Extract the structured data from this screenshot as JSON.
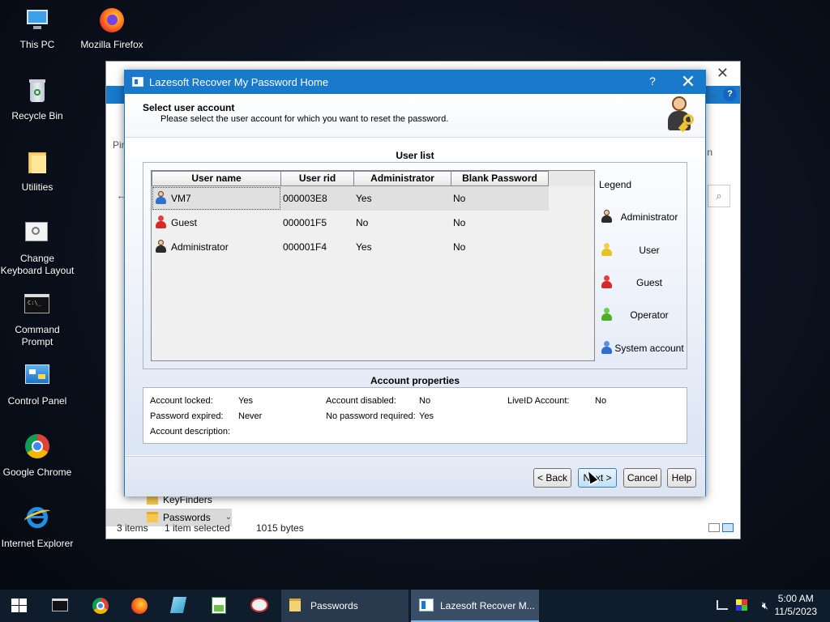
{
  "desktop": {
    "icons": [
      {
        "label": "This PC",
        "icon": "computer-icon"
      },
      {
        "label": "Mozilla Firefox",
        "icon": "firefox-icon"
      },
      {
        "label": "Recycle Bin",
        "icon": "recycle-bin-icon"
      },
      {
        "label": "Utilities",
        "icon": "folder-icon"
      },
      {
        "label": "Change Keyboard Layout",
        "icon": "keyboard-layout-icon"
      },
      {
        "label": "Command Prompt",
        "icon": "command-prompt-icon"
      },
      {
        "label": "Control Panel",
        "icon": "control-panel-icon"
      },
      {
        "label": "Google Chrome",
        "icon": "chrome-icon"
      },
      {
        "label": "Internet Explorer",
        "icon": "internet-explorer-icon"
      }
    ]
  },
  "explorer": {
    "pin_partial": "Pin",
    "edge_partial": "n",
    "nav_items": [
      {
        "label": "KeyFinders"
      },
      {
        "label": "Passwords"
      }
    ],
    "status": {
      "items": "3 items",
      "selected": "1 item selected",
      "size": "1015 bytes"
    }
  },
  "dialog": {
    "title": "Lazesoft Recover My Password Home",
    "help_label": "?",
    "close_label": "✕",
    "header_title": "Select user account",
    "header_subtitle": "Please select the user account for which you want to reset the password.",
    "user_list_title": "User list",
    "columns": [
      "User name",
      "User rid",
      "Administrator",
      "Blank Password"
    ],
    "rows": [
      {
        "name": "VM7",
        "rid": "000003E8",
        "admin": "Yes",
        "blank": "No",
        "type": "administrator",
        "selected": true
      },
      {
        "name": "Guest",
        "rid": "000001F5",
        "admin": "No",
        "blank": "No",
        "type": "guest",
        "selected": false
      },
      {
        "name": "Administrator",
        "rid": "000001F4",
        "admin": "Yes",
        "blank": "No",
        "type": "administrator",
        "selected": false
      }
    ],
    "legend": {
      "title": "Legend",
      "items": [
        {
          "label": "Administrator",
          "type": "administrator"
        },
        {
          "label": "User",
          "type": "user"
        },
        {
          "label": "Guest",
          "type": "guest"
        },
        {
          "label": "Operator",
          "type": "operator"
        },
        {
          "label": "System account",
          "type": "system"
        }
      ]
    },
    "account_properties_title": "Account properties",
    "properties": {
      "locked_label": "Account locked:",
      "locked_value": "Yes",
      "disabled_label": "Account disabled:",
      "disabled_value": "No",
      "liveid_label": "LiveID Account:",
      "liveid_value": "No",
      "expired_label": "Password expired:",
      "expired_value": "Never",
      "nopw_label": "No password required:",
      "nopw_value": "Yes",
      "description_label": "Account description:",
      "description_value": ""
    },
    "buttons": {
      "back": "< Back",
      "next": "Next >",
      "cancel": "Cancel",
      "help": "Help"
    }
  },
  "taskbar": {
    "pinned": [
      "start-icon",
      "command-prompt-icon",
      "chrome-icon",
      "firefox-icon",
      "notepad-icon",
      "spreadsheet-icon",
      "paint-icon"
    ],
    "tasks": [
      {
        "label": "Passwords",
        "icon": "folder-icon"
      },
      {
        "label": "Lazesoft Recover M...",
        "icon": "lazesoft-icon"
      }
    ],
    "clock": {
      "time": "5:00 AM",
      "date": "11/5/2023"
    }
  },
  "colors": {
    "accent": "#1979ca",
    "admin": "#2b2b2b",
    "user": "#e8c21f",
    "guest": "#d62a2a",
    "operator": "#4caf2a",
    "system": "#2f6fd0"
  }
}
